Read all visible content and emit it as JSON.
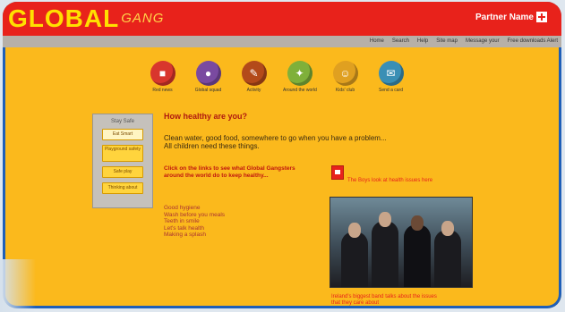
{
  "app": {
    "logo_main": "GLOBAL",
    "logo_sub": "GANG",
    "partner": "Partner Name"
  },
  "navbar": {
    "links": [
      "Home",
      "Search",
      "Help",
      "Site map",
      "Message your",
      "Free downloads Alert"
    ]
  },
  "icons": [
    {
      "label": "Red news",
      "color": "#d8362d",
      "icon": "news-icon"
    },
    {
      "label": "Global squad",
      "color": "#7a4aa0",
      "icon": "globe-icon"
    },
    {
      "label": "Activity",
      "color": "#b34a1a",
      "icon": "activity-icon"
    },
    {
      "label": "Around the world",
      "color": "#7fb03a",
      "icon": "world-icon"
    },
    {
      "label": "Kids' club",
      "color": "#e0a020",
      "icon": "club-icon"
    },
    {
      "label": "Send a card",
      "color": "#3a8fb5",
      "icon": "card-icon"
    }
  ],
  "sidebar": {
    "title": "Stay Safe",
    "buttons": [
      "Eat Smart",
      "Playground safety",
      "Safe play",
      "Thinking about"
    ]
  },
  "main": {
    "heading": "How healthy are you?",
    "intro": [
      "Clean water, good food, somewhere to go when you have a problem...",
      "All children need these things."
    ],
    "click_text": "Click on the links to see what Global Gangsters around the world do to keep healthy...",
    "tips": [
      "Good hygiene",
      "Wash before you meals",
      "Teeth in smile",
      "Let's talk health",
      "Making a splash"
    ],
    "redlink": "The Boys look at health issues here",
    "caption": [
      "Ireland's biggest band talks about the issues",
      "that they care about"
    ]
  }
}
